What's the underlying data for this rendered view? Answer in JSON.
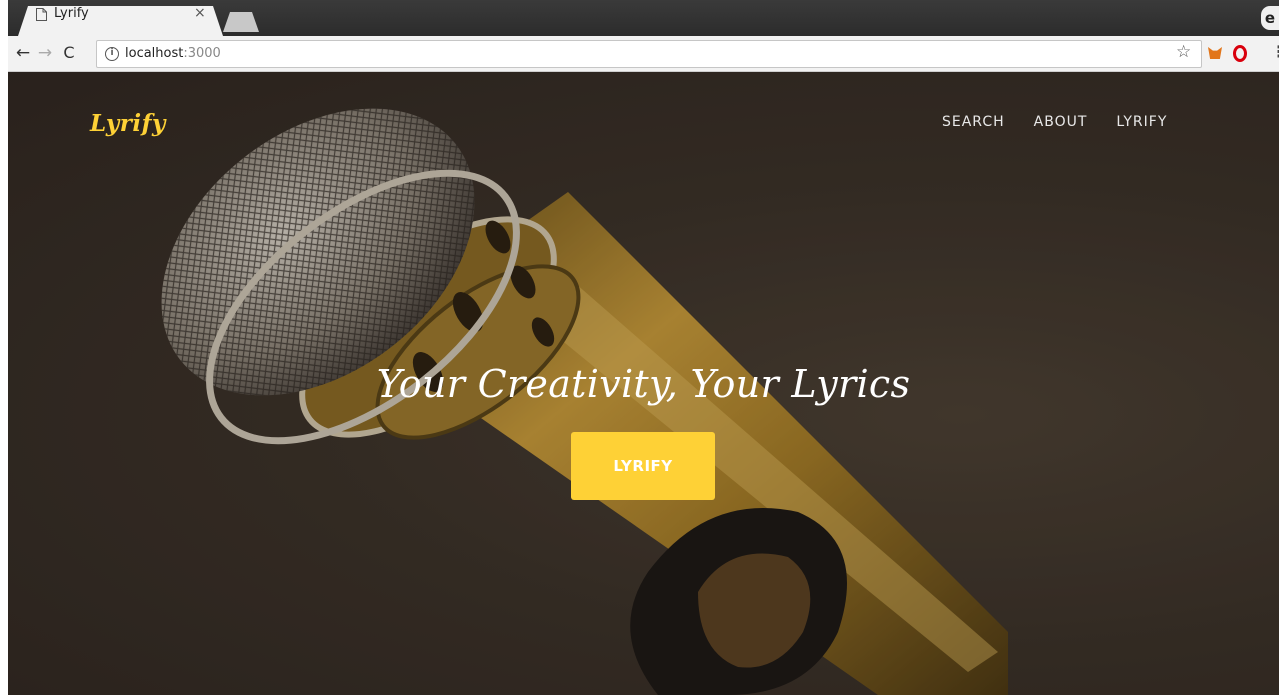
{
  "browser": {
    "tab": {
      "title": "Lyrify",
      "close": "×"
    },
    "toolbar": {
      "back": "←",
      "forward": "→",
      "reload": "C",
      "info": "i",
      "url_host": "localhost",
      "url_port": ":3000",
      "bookmark": "☆",
      "menu": "⋮"
    },
    "profile": "e"
  },
  "page": {
    "brand": "Lyrify",
    "nav": [
      {
        "label": "SEARCH"
      },
      {
        "label": "ABOUT"
      },
      {
        "label": "LYRIFY"
      }
    ],
    "hero": {
      "tagline": "Your Creativity, Your Lyrics",
      "cta_label": "LYRIFY"
    }
  },
  "colors": {
    "accent": "#fed136",
    "background": "#2e2621",
    "text": "#ffffff"
  }
}
